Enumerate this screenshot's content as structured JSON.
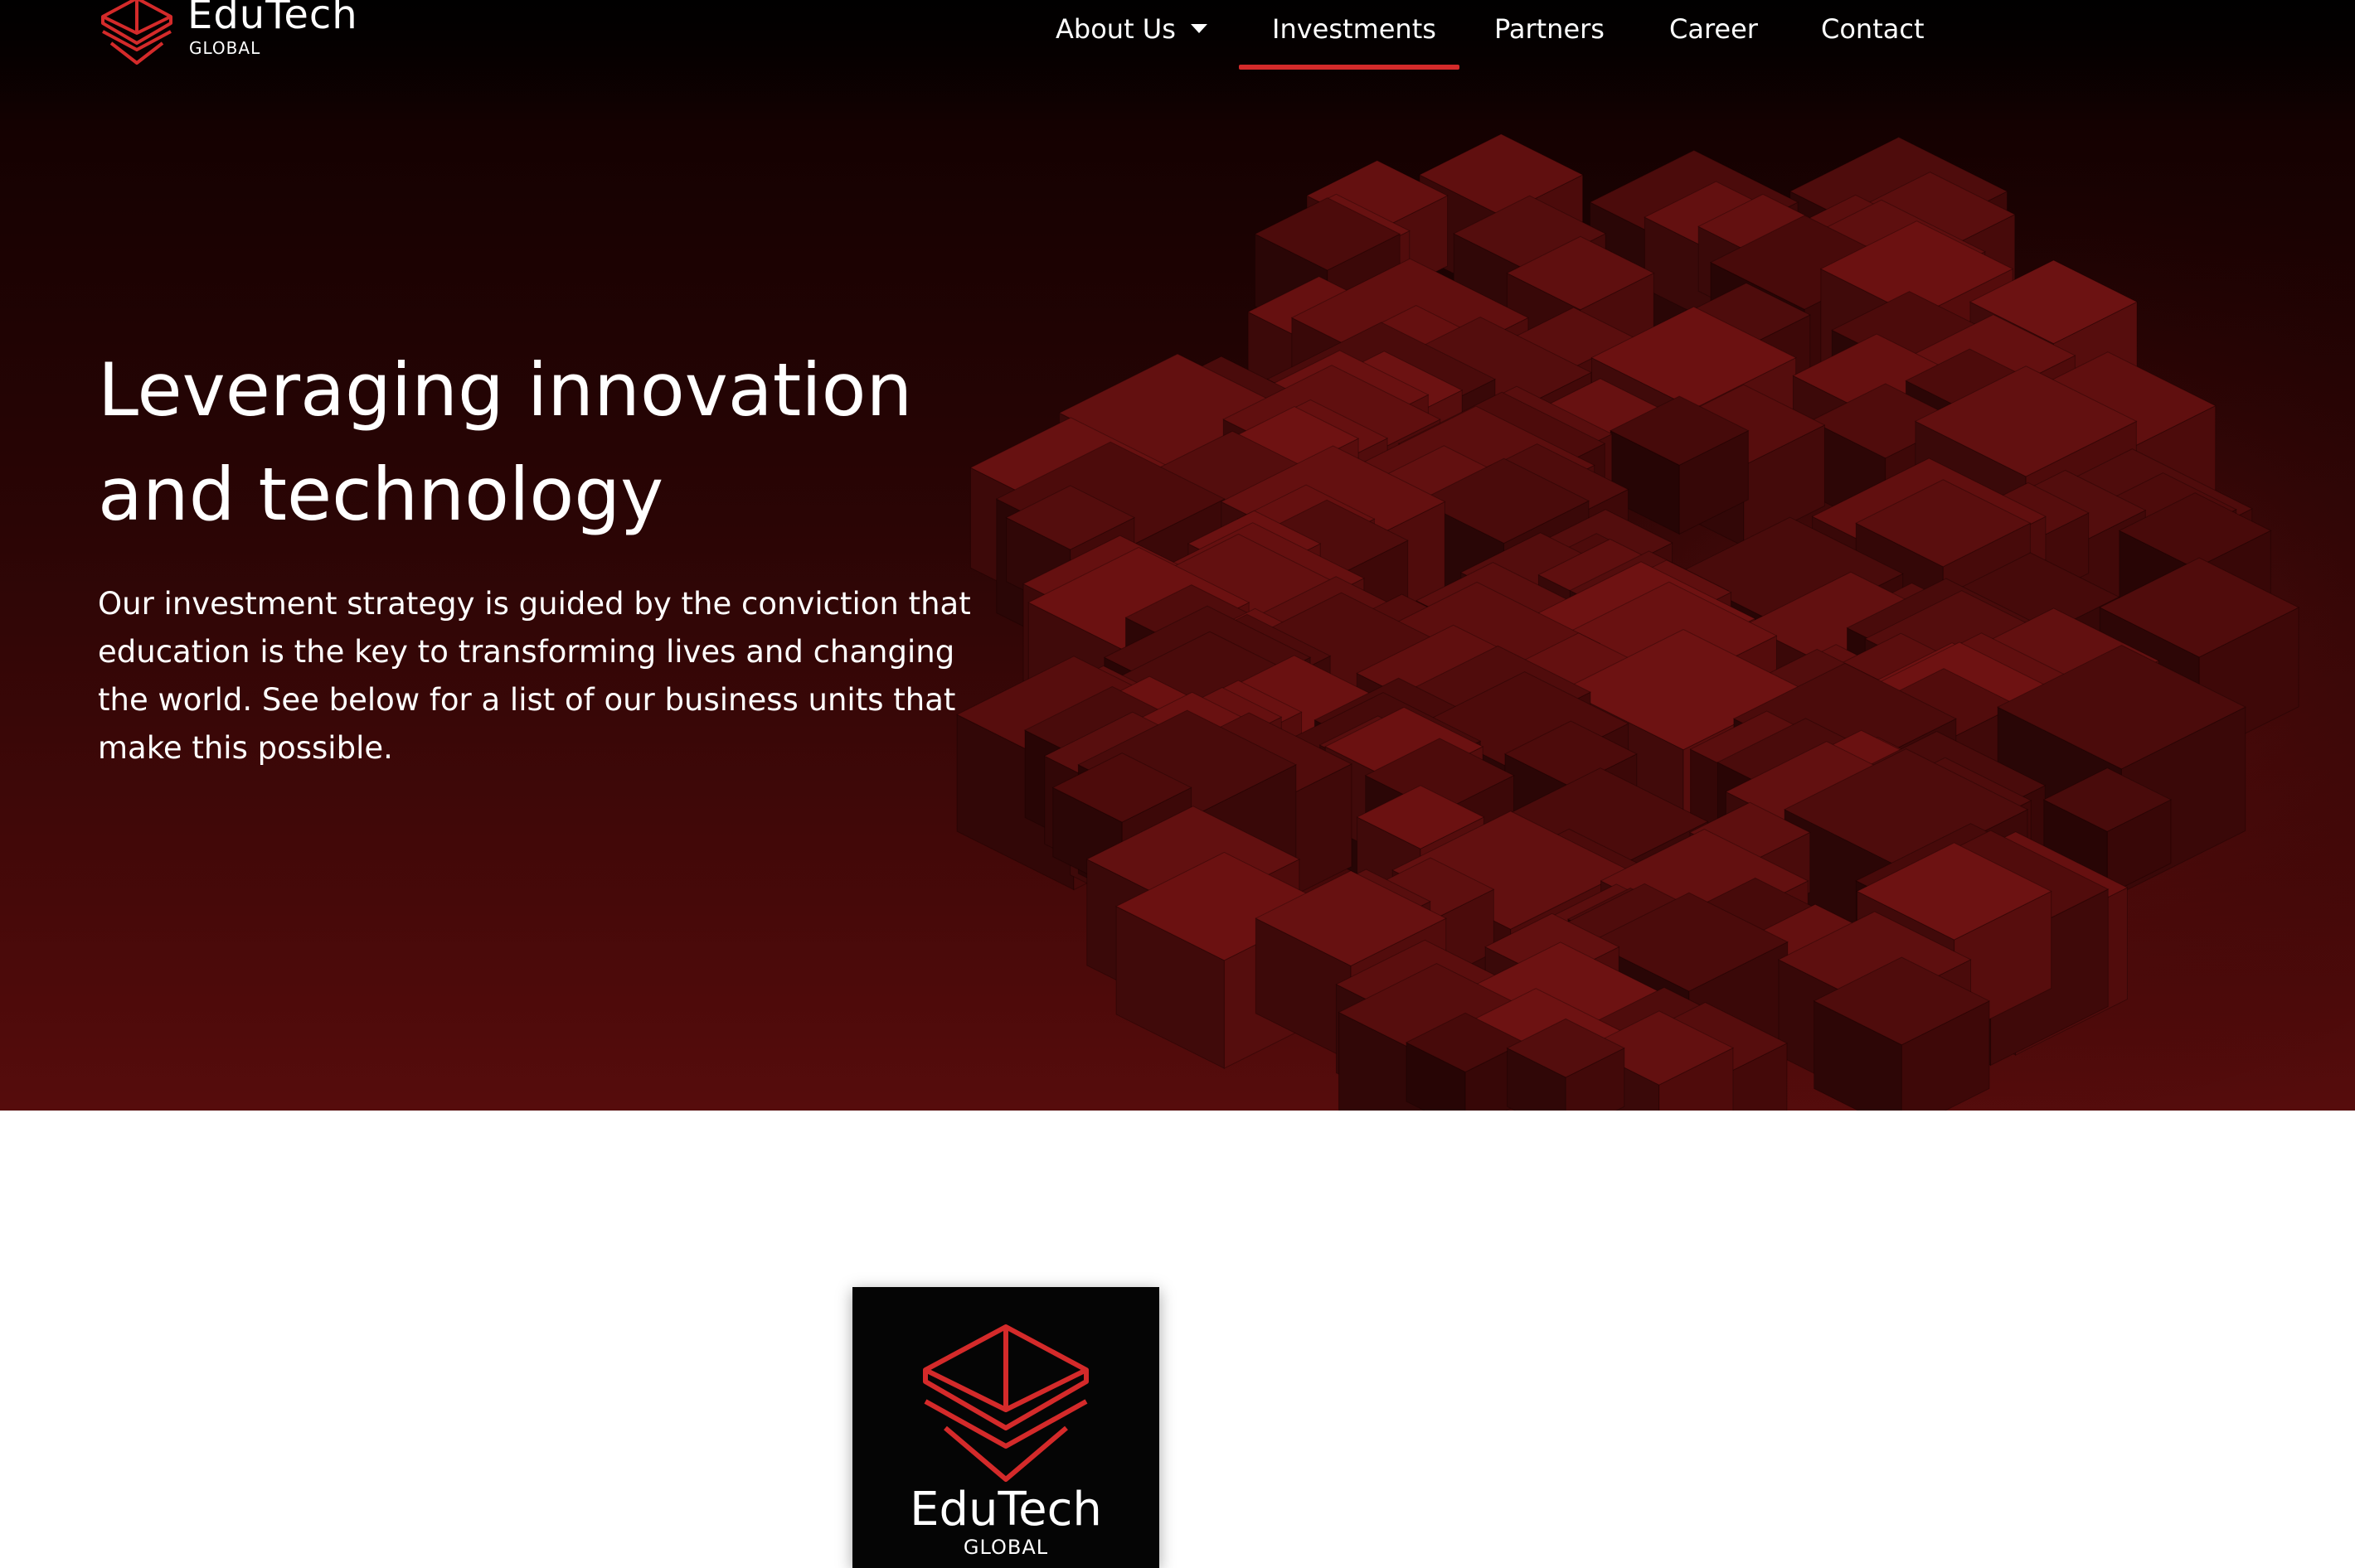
{
  "brand": {
    "name": "EduTech",
    "subtitle": "GLOBAL",
    "accent": "#d42a2a"
  },
  "nav": {
    "items": [
      {
        "label": "About Us",
        "has_dropdown": true,
        "active": false
      },
      {
        "label": "Investments",
        "has_dropdown": false,
        "active": true
      },
      {
        "label": "Partners",
        "has_dropdown": false,
        "active": false
      },
      {
        "label": "Career",
        "has_dropdown": false,
        "active": false
      },
      {
        "label": "Contact",
        "has_dropdown": false,
        "active": false
      }
    ],
    "dropdown_icon": "caret-down-icon"
  },
  "hero": {
    "title_line1": "Leveraging innovation",
    "title_line2": "and technology",
    "body": "Our investment strategy is guided by the conviction that education is the key to transforming lives and changing the world. See below for a list of our business units that make this possible.",
    "background_colors": [
      "#060000",
      "#2b0505",
      "#560c0c"
    ]
  },
  "card": {
    "name": "EduTech",
    "subtitle": "GLOBAL",
    "background": "#050505"
  }
}
